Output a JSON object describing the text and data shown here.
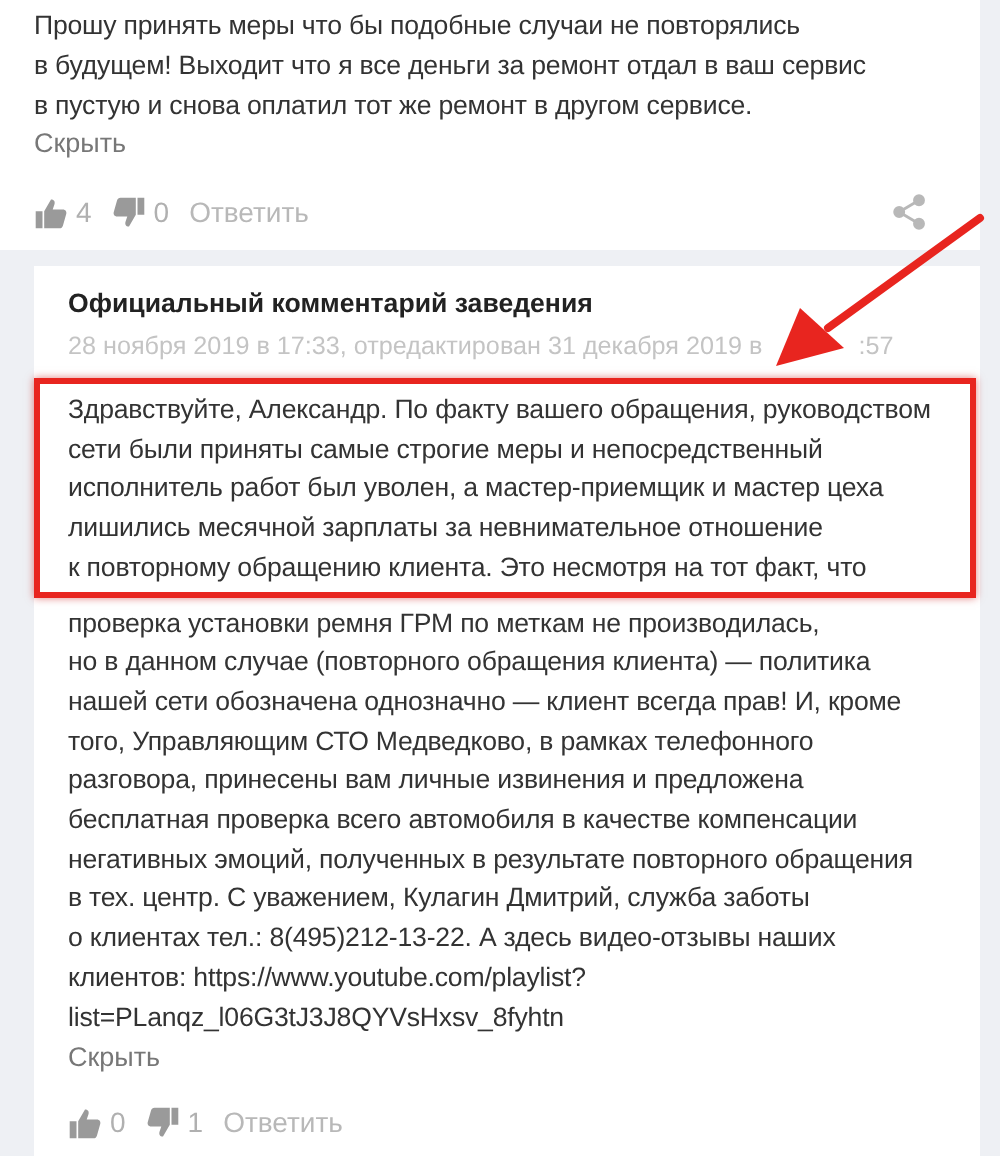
{
  "review": {
    "lines": [
      "Прошу принять меры что бы подобные случаи не повторялись",
      "в будущем! Выходит что я все деньги за ремонт отдал в ваш сервис",
      "в пустую и снова оплатил тот же ремонт в другом сервисе."
    ],
    "hide_link": "Скрыть",
    "likes": "4",
    "dislikes": "0",
    "reply_button": "Ответить"
  },
  "official_reply": {
    "title": "Официальный комментарий заведения",
    "date_parts": [
      "28 ноября 2019 в 17:33, отредактирован 31 декабря 2019 в",
      ":57"
    ],
    "highlighted_lines": [
      "Здравствуйте, Александр. По факту вашего обращения, руководством",
      "сети были приняты самые строгие меры и непосредственный",
      "исполнитель работ был уволен, а мастер-приемщик и мастер цеха",
      "лишились месячной зарплаты за невнимательное отношение",
      "к повторному обращению клиента. Это несмотря на тот факт, что"
    ],
    "more_lines": [
      "проверка установки ремня ГРМ по меткам не производилась,",
      "но в данном случае (повторного обращения клиента) — политика",
      "нашей сети обозначена однозначно — клиент всегда прав! И, кроме",
      "того, Управляющим СТО Медведково, в рамках телефонного",
      "разговора, принесены вам личные извинения и предложена",
      "бесплатная проверка всего автомобиля в качестве компенсации",
      "негативных эмоций, полученных в результате повторного обращения",
      "в тех. центр. С уважением, Кулагин Дмитрий, служба заботы",
      "о клиентах тел.: 8(495)212-13-22. А здесь видео-отзывы наших",
      "клиентов: https://www.youtube.com/playlist?",
      "list=PLanqz_l06G3tJ3J8QYVsHxsv_8fyhtn"
    ],
    "hide_link": "Скрыть",
    "likes": "0",
    "dislikes": "1",
    "reply_button": "Ответить"
  }
}
